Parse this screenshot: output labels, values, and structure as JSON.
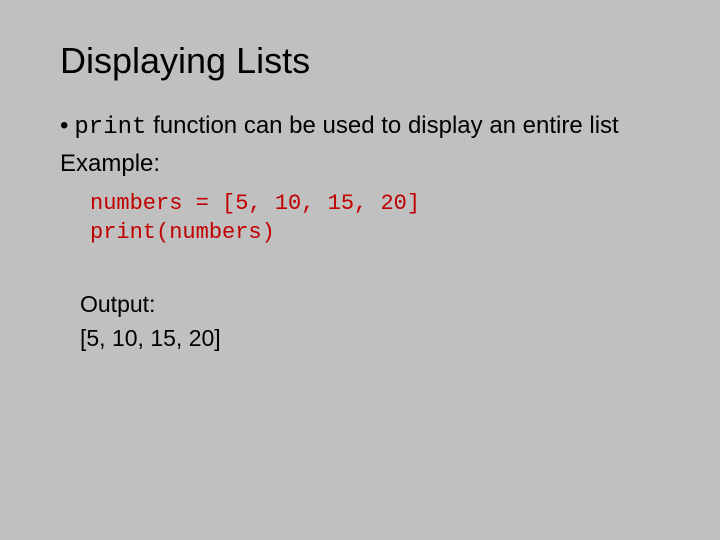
{
  "title": "Displaying Lists",
  "bullet": {
    "marker": "•",
    "code": "print",
    "text_after": " function can be used to display an entire list"
  },
  "example_label": "Example:",
  "code": {
    "line1": "numbers = [5, 10, 15, 20]",
    "line2": "print(numbers)"
  },
  "output": {
    "label": "Output:",
    "value": "[5, 10, 15, 20]"
  }
}
